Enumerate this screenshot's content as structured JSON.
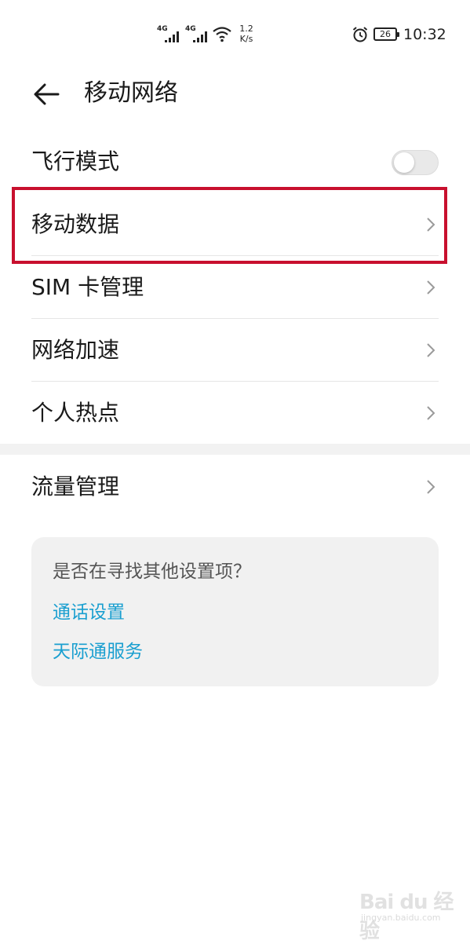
{
  "status_bar": {
    "sim1_network": "4G",
    "sim2_network": "4G",
    "speed_value": "1.2",
    "speed_unit": "K/s",
    "battery": "26",
    "time": "10:32"
  },
  "header": {
    "title": "移动网络"
  },
  "list": {
    "items": [
      {
        "label": "飞行模式",
        "type": "toggle",
        "on": false
      },
      {
        "label": "移动数据",
        "type": "nav",
        "highlighted": true
      },
      {
        "label": "SIM 卡管理",
        "type": "nav"
      },
      {
        "label": "网络加速",
        "type": "nav"
      },
      {
        "label": "个人热点",
        "type": "nav"
      },
      {
        "label": "流量管理",
        "type": "nav"
      }
    ]
  },
  "suggestion": {
    "question": "是否在寻找其他设置项？",
    "links": [
      "通话设置",
      "天际通服务"
    ]
  },
  "colors": {
    "highlight_border": "#c8102e",
    "link": "#1a9fd0",
    "card_background": "#f1f1f1"
  },
  "watermark": {
    "brand": "Bai du 经验",
    "url": "jingyan.baidu.com"
  }
}
